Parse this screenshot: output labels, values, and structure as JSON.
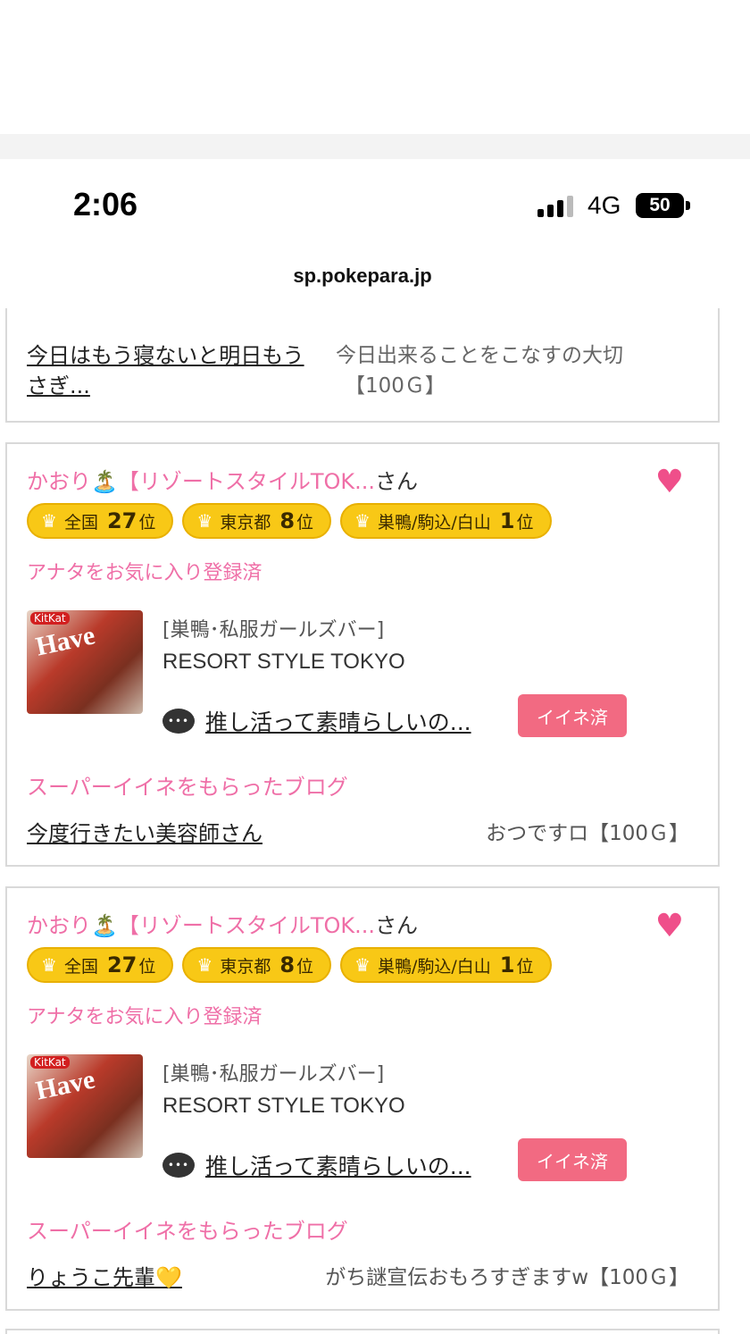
{
  "status_bar": {
    "time": "2:06",
    "network": "4G",
    "battery": "50"
  },
  "browser": {
    "url": "sp.pokepara.jp"
  },
  "partial_card": {
    "blog_title": "今日はもう寝ないと明日もう\nさぎ...",
    "blog_title_line1": "今日はもう寝ないと明日もう",
    "blog_title_line2": "さぎ...",
    "blog_sub_line1": "今日出来ることをこなすの大切",
    "blog_sub_line2": "【100Ｇ】"
  },
  "cards": [
    {
      "name": "かおり🏝️【リゾートスタイルTOK...",
      "san": "さん",
      "heart_icon": "heart-icon",
      "badges": [
        {
          "area": "全国",
          "rank": "27",
          "suffix": "位"
        },
        {
          "area": "東京都",
          "rank": "8",
          "suffix": "位"
        },
        {
          "area": "巣鴨/駒込/白山",
          "rank": "1",
          "suffix": "位"
        }
      ],
      "favorite_text": "アナタをお気に入り登録済",
      "shop_category": "[巣鴨･私服ガールズバー]",
      "shop_name": "RESORT STYLE TOKYO",
      "comment": "推し活って素晴らしいの...",
      "iine_label": "イイネ済",
      "blog_heading": "スーパーイイネをもらったブログ",
      "blog_title": "今度行きたい美容師さん",
      "blog_sub": "おつですロ【100Ｇ】"
    },
    {
      "name": "かおり🏝️【リゾートスタイルTOK...",
      "san": "さん",
      "heart_icon": "heart-icon",
      "badges": [
        {
          "area": "全国",
          "rank": "27",
          "suffix": "位"
        },
        {
          "area": "東京都",
          "rank": "8",
          "suffix": "位"
        },
        {
          "area": "巣鴨/駒込/白山",
          "rank": "1",
          "suffix": "位"
        }
      ],
      "favorite_text": "アナタをお気に入り登録済",
      "shop_category": "[巣鴨･私服ガールズバー]",
      "shop_name": "RESORT STYLE TOKYO",
      "comment": "推し活って素晴らしいの...",
      "iine_label": "イイネ済",
      "blog_heading": "スーパーイイネをもらったブログ",
      "blog_title": "りょうこ先輩💛",
      "blog_sub": "がち謎宣伝おもろすぎますw【100Ｇ】"
    }
  ],
  "thumb": {
    "brand": "KitKat",
    "text": "Have"
  },
  "colors": {
    "pink": "#ef6fa7",
    "badge": "#f8c816",
    "iine": "#f26a82",
    "heart": "#ef4f8a"
  }
}
